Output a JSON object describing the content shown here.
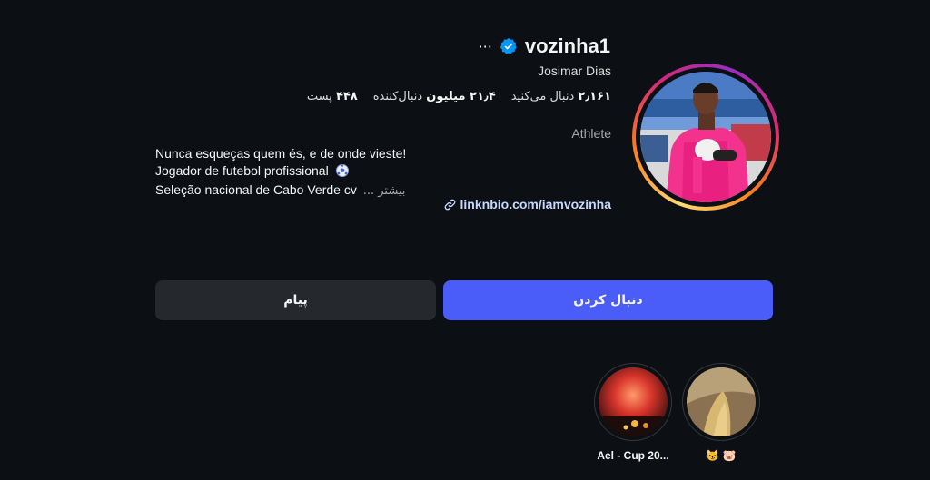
{
  "profile": {
    "username": "vozinha1",
    "full_name": "Josimar Dias",
    "category": "Athlete",
    "more_label": "···",
    "verified_icon": "verified-badge-icon",
    "accent_color": "#4a5df9"
  },
  "stats": {
    "posts_count": "۴۴۸",
    "posts_label": "پست",
    "followers_count": "۲۱٫۴ میلیون",
    "followers_label": "دنبال‌کننده",
    "following_count": "۲٫۱۶۱",
    "following_label": "دنبال می‌کنید"
  },
  "bio": {
    "line1": "Nunca esqueças quem és, e de onde vieste!",
    "line2": "Jogador de futebol profissional",
    "line3": "Seleção nacional de Cabo Verde cv",
    "more": "... بیشتر",
    "link": "linknbio.com/iamvozinha"
  },
  "buttons": {
    "follow": "دنبال کردن",
    "message": "پیام"
  },
  "highlights": [
    {
      "label": "Ael - Cup 20..."
    },
    {
      "label": "😼 🐷"
    }
  ]
}
